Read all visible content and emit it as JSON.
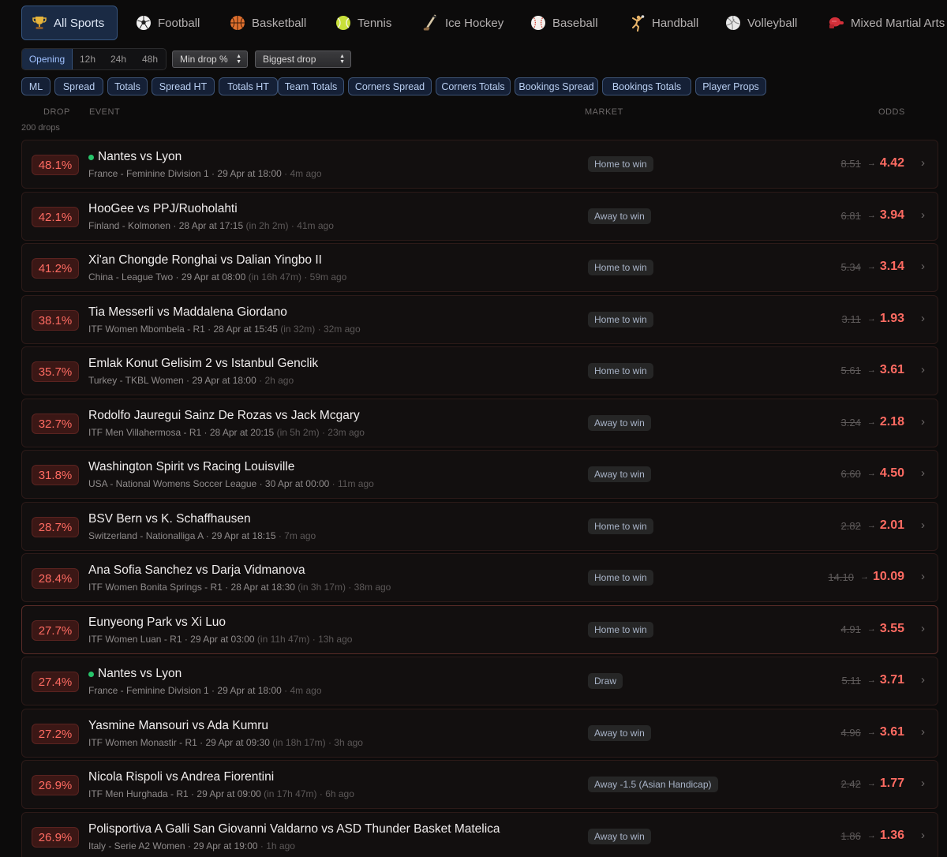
{
  "sports": [
    {
      "label": "All Sports",
      "icon": "trophy-icon",
      "active": true
    },
    {
      "label": "Football",
      "icon": "soccer-ball-icon",
      "active": false
    },
    {
      "label": "Basketball",
      "icon": "basketball-icon",
      "active": false
    },
    {
      "label": "Tennis",
      "icon": "tennis-ball-icon",
      "active": false
    },
    {
      "label": "Ice Hockey",
      "icon": "hockey-stick-icon",
      "active": false
    },
    {
      "label": "Baseball",
      "icon": "baseball-icon",
      "active": false
    },
    {
      "label": "Handball",
      "icon": "handball-player-icon",
      "active": false
    },
    {
      "label": "Volleyball",
      "icon": "volleyball-icon",
      "active": false
    },
    {
      "label": "Mixed Martial Arts",
      "icon": "boxing-glove-icon",
      "active": false
    }
  ],
  "time_filters": [
    {
      "label": "Opening",
      "active": true
    },
    {
      "label": "12h",
      "active": false
    },
    {
      "label": "24h",
      "active": false
    },
    {
      "label": "48h",
      "active": false
    }
  ],
  "selects": {
    "min_drop": "Min drop %",
    "sort": "Biggest drop"
  },
  "markets": [
    "ML",
    "Spread",
    "Totals",
    "Spread HT",
    "Totals HT",
    "Team Totals",
    "Corners Spread",
    "Corners Totals",
    "Bookings Spread",
    "Bookings Totals",
    "Player Props"
  ],
  "columns": {
    "drop": "DROP",
    "event": "EVENT",
    "market": "MARKET",
    "odds": "ODDS"
  },
  "drops_count": "200 drops",
  "colors": {
    "background": "#0c0b0b",
    "drop_red": "#ff6b62",
    "active_blue": "#1a2a44",
    "live_green": "#27c46a"
  },
  "rows": [
    {
      "drop": "48.1%",
      "live": true,
      "event": "Nantes vs Lyon",
      "league": "France - Feminine Division 1",
      "time": "29 Apr at 18:00",
      "until": "",
      "ago": "4m ago",
      "market": "Home to win",
      "old": "8.51",
      "new": "4.42"
    },
    {
      "drop": "42.1%",
      "live": false,
      "event": "HooGee vs PPJ/Ruoholahti",
      "league": "Finland - Kolmonen",
      "time": "28 Apr at 17:15",
      "until": "(in 2h 2m)",
      "ago": "41m ago",
      "market": "Away to win",
      "old": "6.81",
      "new": "3.94"
    },
    {
      "drop": "41.2%",
      "live": false,
      "event": "Xi'an Chongde Ronghai vs Dalian Yingbo II",
      "league": "China - League Two",
      "time": "29 Apr at 08:00",
      "until": "(in 16h 47m)",
      "ago": "59m ago",
      "market": "Home to win",
      "old": "5.34",
      "new": "3.14"
    },
    {
      "drop": "38.1%",
      "live": false,
      "event": "Tia Messerli vs Maddalena Giordano",
      "league": "ITF Women Mbombela - R1",
      "time": "28 Apr at 15:45",
      "until": "(in 32m)",
      "ago": "32m ago",
      "market": "Home to win",
      "old": "3.11",
      "new": "1.93"
    },
    {
      "drop": "35.7%",
      "live": false,
      "event": "Emlak Konut Gelisim 2 vs Istanbul Genclik",
      "league": "Turkey - TKBL Women",
      "time": "29 Apr at 18:00",
      "until": "",
      "ago": "2h ago",
      "market": "Home to win",
      "old": "5.61",
      "new": "3.61"
    },
    {
      "drop": "32.7%",
      "live": false,
      "event": "Rodolfo Jauregui Sainz De Rozas vs Jack Mcgary",
      "league": "ITF Men Villahermosa - R1",
      "time": "28 Apr at 20:15",
      "until": "(in 5h 2m)",
      "ago": "23m ago",
      "market": "Away to win",
      "old": "3.24",
      "new": "2.18"
    },
    {
      "drop": "31.8%",
      "live": false,
      "event": "Washington Spirit vs Racing Louisville",
      "league": "USA - National Womens Soccer League",
      "time": "30 Apr at 00:00",
      "until": "",
      "ago": "11m ago",
      "market": "Away to win",
      "old": "6.60",
      "new": "4.50"
    },
    {
      "drop": "28.7%",
      "live": false,
      "event": "BSV Bern vs K. Schaffhausen",
      "league": "Switzerland - Nationalliga A",
      "time": "29 Apr at 18:15",
      "until": "",
      "ago": "7m ago",
      "market": "Home to win",
      "old": "2.82",
      "new": "2.01"
    },
    {
      "drop": "28.4%",
      "live": false,
      "event": "Ana Sofia Sanchez vs Darja Vidmanova",
      "league": "ITF Women Bonita Springs - R1",
      "time": "28 Apr at 18:30",
      "until": "(in 3h 17m)",
      "ago": "38m ago",
      "market": "Home to win",
      "old": "14.10",
      "new": "10.09"
    },
    {
      "drop": "27.7%",
      "live": false,
      "event": "Eunyeong Park vs Xi Luo",
      "league": "ITF Women Luan - R1",
      "time": "29 Apr at 03:00",
      "until": "(in 11h 47m)",
      "ago": "13h ago",
      "market": "Home to win",
      "old": "4.91",
      "new": "3.55"
    },
    {
      "drop": "27.4%",
      "live": true,
      "event": "Nantes vs Lyon",
      "league": "France - Feminine Division 1",
      "time": "29 Apr at 18:00",
      "until": "",
      "ago": "4m ago",
      "market": "Draw",
      "old": "5.11",
      "new": "3.71"
    },
    {
      "drop": "27.2%",
      "live": false,
      "event": "Yasmine Mansouri vs Ada Kumru",
      "league": "ITF Women Monastir - R1",
      "time": "29 Apr at 09:30",
      "until": "(in 18h 17m)",
      "ago": "3h ago",
      "market": "Away to win",
      "old": "4.96",
      "new": "3.61"
    },
    {
      "drop": "26.9%",
      "live": false,
      "event": "Nicola Rispoli vs Andrea Fiorentini",
      "league": "ITF Men Hurghada - R1",
      "time": "29 Apr at 09:00",
      "until": "(in 17h 47m)",
      "ago": "6h ago",
      "market": "Away -1.5 (Asian Handicap)",
      "old": "2.42",
      "new": "1.77"
    },
    {
      "drop": "26.9%",
      "live": false,
      "event": "Polisportiva A Galli San Giovanni Valdarno vs ASD Thunder Basket Matelica",
      "league": "Italy - Serie A2 Women",
      "time": "29 Apr at 19:00",
      "until": "",
      "ago": "1h ago",
      "market": "Away to win",
      "old": "1.86",
      "new": "1.36"
    }
  ]
}
